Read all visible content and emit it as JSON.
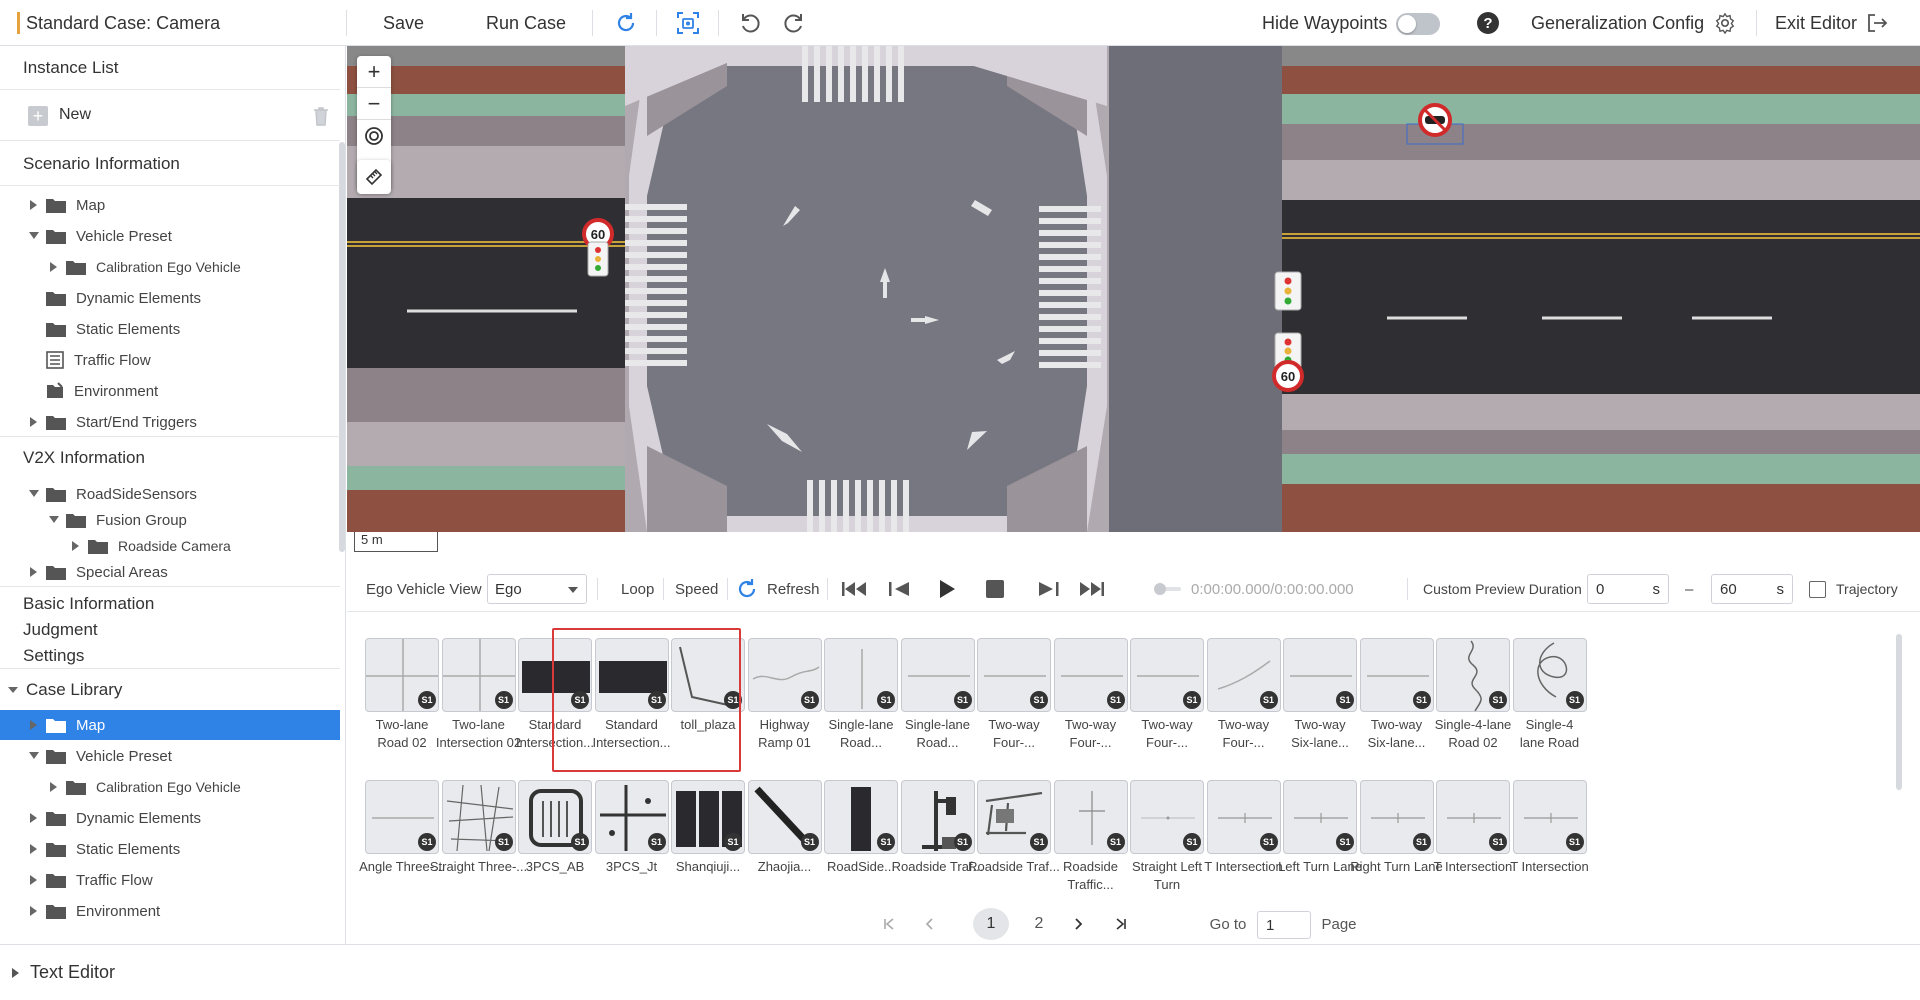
{
  "topbar": {
    "case_title": "Standard Case: Camera",
    "save_label": "Save",
    "run_case_label": "Run Case",
    "hide_waypoints_label": "Hide Waypoints",
    "generalization_label": "Generalization Config",
    "exit_editor_label": "Exit Editor"
  },
  "sidebar": {
    "instance_list_title": "Instance List",
    "new_label": "New",
    "scenario_info_title": "Scenario Information",
    "scenario_tree": [
      {
        "label": "Map"
      },
      {
        "label": "Vehicle Preset"
      },
      {
        "label": "Calibration Ego Vehicle"
      },
      {
        "label": "Dynamic Elements"
      },
      {
        "label": "Static Elements"
      },
      {
        "label": "Traffic Flow"
      },
      {
        "label": "Environment"
      },
      {
        "label": "Start/End Triggers"
      }
    ],
    "v2x_title": "V2X Information",
    "v2x_tree": [
      {
        "label": "RoadSideSensors"
      },
      {
        "label": "Fusion Group"
      },
      {
        "label": "Roadside Camera"
      },
      {
        "label": "Special Areas"
      }
    ],
    "basic_info": "Basic Information",
    "judgment": "Judgment",
    "settings": "Settings",
    "case_library_title": "Case Library",
    "library_tree": [
      {
        "label": "Map"
      },
      {
        "label": "Vehicle Preset"
      },
      {
        "label": "Calibration Ego Vehicle"
      },
      {
        "label": "Dynamic Elements"
      },
      {
        "label": "Static Elements"
      },
      {
        "label": "Traffic Flow"
      },
      {
        "label": "Environment"
      }
    ],
    "text_editor": "Text Editor"
  },
  "map": {
    "speed_limit_1": "60",
    "speed_limit_2": "60",
    "scale_label": "5 m"
  },
  "controls": {
    "ego_view_label": "Ego Vehicle View",
    "ego_value": "Ego",
    "loop_label": "Loop",
    "speed_label": "Speed",
    "refresh_label": "Refresh",
    "time_display": "0:00:00.000/0:00:00.000",
    "preview_label": "Custom Preview Duration",
    "start_value": "0",
    "start_unit": "s",
    "range_sep": "–",
    "end_value": "60",
    "end_unit": "s",
    "trajectory_label": "Trajectory"
  },
  "library": {
    "badge": "S1",
    "row1": [
      {
        "label": "Two-lane\nRoad 02",
        "thumb": "cross"
      },
      {
        "label": "Two-lane\nIntersection 02",
        "thumb": "cross"
      },
      {
        "label": "Standard\nIntersection...",
        "thumb": "darkbar"
      },
      {
        "label": "Standard\nIntersection...",
        "thumb": "darkbar"
      },
      {
        "label": "toll_plaza",
        "thumb": "toll"
      },
      {
        "label": "Highway\nRamp 01",
        "thumb": "ramp"
      },
      {
        "label": "Single-lane\nRoad...",
        "thumb": "vline"
      },
      {
        "label": "Single-lane\nRoad...",
        "thumb": "hline"
      },
      {
        "label": "Two-way\nFour-...",
        "thumb": "hline"
      },
      {
        "label": "Two-way\nFour-...",
        "thumb": "hline"
      },
      {
        "label": "Two-way\nFour-...",
        "thumb": "hline"
      },
      {
        "label": "Two-way\nFour-...",
        "thumb": "curve"
      },
      {
        "label": "Two-way\nSix-lane...",
        "thumb": "hline"
      },
      {
        "label": "Two-way\nSix-lane...",
        "thumb": "hline"
      },
      {
        "label": "Single-4-lane\nRoad 02",
        "thumb": "squiggle"
      },
      {
        "label": "Single-4\nlane Road",
        "thumb": "loops"
      }
    ],
    "row2": [
      {
        "label": "Angle Three-...",
        "thumb": "hline"
      },
      {
        "label": "Straight Three-...",
        "thumb": "grid"
      },
      {
        "label": "3PCS_AB",
        "thumb": "gate"
      },
      {
        "label": "3PCS_Jt",
        "thumb": "tcross"
      },
      {
        "label": "Shanqiuji...",
        "thumb": "panels"
      },
      {
        "label": "Zhaojia...",
        "thumb": "diag"
      },
      {
        "label": "RoadSide...",
        "thumb": "vbar"
      },
      {
        "label": "Roadside Traf...",
        "thumb": "tower"
      },
      {
        "label": "Roadside Traf...",
        "thumb": "gantry"
      },
      {
        "label": "Roadside Traffic...",
        "thumb": "thin"
      },
      {
        "label": "Straight Left Turn",
        "thumb": "dot"
      },
      {
        "label": "T Intersection",
        "thumb": "tsmall"
      },
      {
        "label": "Left Turn Lane",
        "thumb": "tsmall"
      },
      {
        "label": "Right Turn Lane",
        "thumb": "tsmall"
      },
      {
        "label": "T Intersection",
        "thumb": "tsmall"
      },
      {
        "label": "T Intersection",
        "thumb": "tsmall"
      }
    ]
  },
  "pagination": {
    "current_page": "1",
    "page_2": "2",
    "goto_label": "Go to",
    "goto_value": "1",
    "page_label": "Page"
  },
  "colors": {
    "accent": "#2f82e6",
    "selection_border": "#d83a3a",
    "road": "#2e2e33",
    "sidewalk": "#8b7e80",
    "green_strip": "#8cb5a0",
    "brown_strip": "#8e5141"
  }
}
